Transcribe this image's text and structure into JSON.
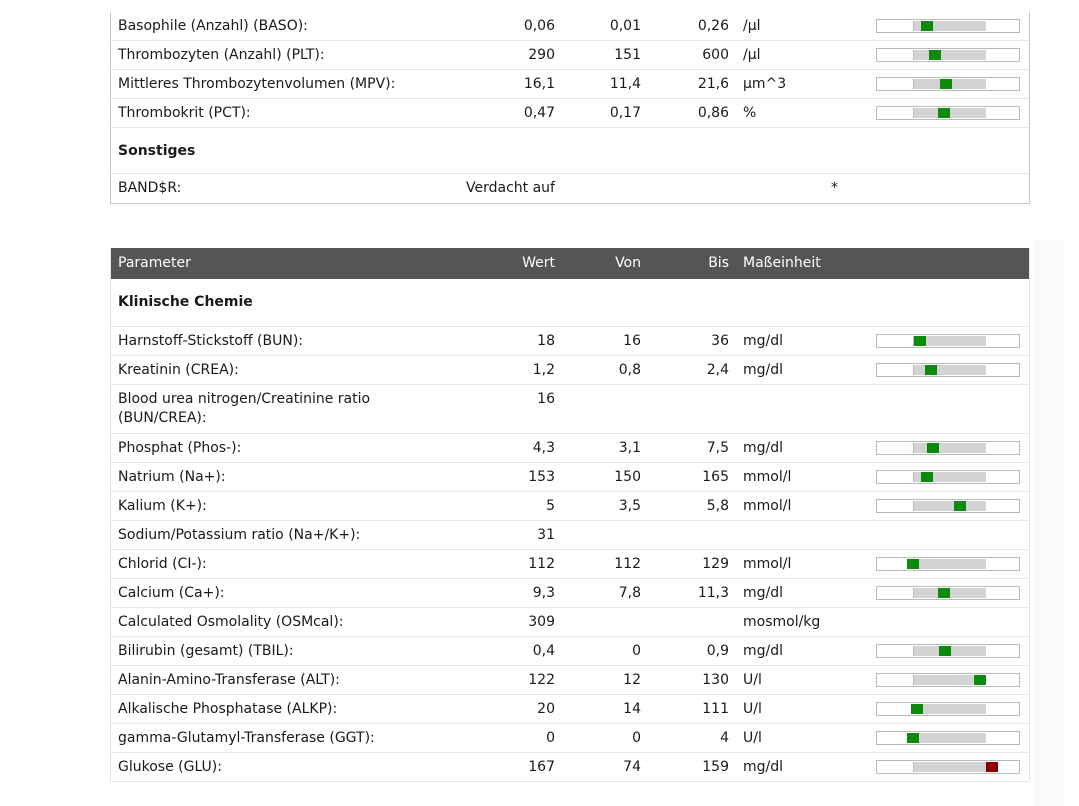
{
  "panel1": {
    "rows": [
      {
        "name": "Basophile (Anzahl) (BASO):",
        "wert": "0,06",
        "von": "0,01",
        "bis": "0,26",
        "unit": "/µl",
        "gauge": {
          "value": 0.06,
          "min": 0.01,
          "max": 0.26
        }
      },
      {
        "name": "Thrombozyten (Anzahl) (PLT):",
        "wert": "290",
        "von": "151",
        "bis": "600",
        "unit": "/µl",
        "gauge": {
          "value": 290,
          "min": 151,
          "max": 600
        }
      },
      {
        "name": "Mittleres Thrombozytenvolumen (MPV):",
        "wert": "16,1",
        "von": "11,4",
        "bis": "21,6",
        "unit": "µm^3",
        "gauge": {
          "value": 16.1,
          "min": 11.4,
          "max": 21.6
        }
      },
      {
        "name": "Thrombokrit (PCT):",
        "wert": "0,47",
        "von": "0,17",
        "bis": "0,86",
        "unit": "%",
        "gauge": {
          "value": 0.47,
          "min": 0.17,
          "max": 0.86
        }
      }
    ],
    "section": "Sonstiges",
    "band": {
      "name": "BAND$R:",
      "wert": "Verdacht auf",
      "flag": "*"
    }
  },
  "panel2": {
    "header": {
      "parameter": "Parameter",
      "wert": "Wert",
      "von": "Von",
      "bis": "Bis",
      "unit": "Maßeinheit"
    },
    "section": "Klinische Chemie",
    "rows": [
      {
        "name": "Harnstoff-Stickstoff (BUN):",
        "wert": "18",
        "von": "16",
        "bis": "36",
        "unit": "mg/dl",
        "gauge": {
          "value": 18,
          "min": 16,
          "max": 36
        }
      },
      {
        "name": "Kreatinin (CREA):",
        "wert": "1,2",
        "von": "0,8",
        "bis": "2,4",
        "unit": "mg/dl",
        "gauge": {
          "value": 1.2,
          "min": 0.8,
          "max": 2.4
        }
      },
      {
        "name": "Blood urea nitrogen/Creatinine ratio (BUN/CREA):",
        "wert": "16",
        "multi": true
      },
      {
        "name": "Phosphat (Phos-):",
        "wert": "4,3",
        "von": "3,1",
        "bis": "7,5",
        "unit": "mg/dl",
        "gauge": {
          "value": 4.3,
          "min": 3.1,
          "max": 7.5
        }
      },
      {
        "name": "Natrium (Na+):",
        "wert": "153",
        "von": "150",
        "bis": "165",
        "unit": "mmol/l",
        "gauge": {
          "value": 153,
          "min": 150,
          "max": 165
        }
      },
      {
        "name": "Kalium (K+):",
        "wert": "5",
        "von": "3,5",
        "bis": "5,8",
        "unit": "mmol/l",
        "gauge": {
          "value": 5,
          "min": 3.5,
          "max": 5.8
        }
      },
      {
        "name": "Sodium/Potassium ratio (Na+/K+):",
        "wert": "31"
      },
      {
        "name": "Chlorid (CI-):",
        "wert": "112",
        "von": "112",
        "bis": "129",
        "unit": "mmol/l",
        "gauge": {
          "value": 112,
          "min": 112,
          "max": 129
        }
      },
      {
        "name": "Calcium (Ca+):",
        "wert": "9,3",
        "von": "7,8",
        "bis": "11,3",
        "unit": "mg/dl",
        "gauge": {
          "value": 9.3,
          "min": 7.8,
          "max": 11.3
        }
      },
      {
        "name": "Calculated Osmolality (OSMcal):",
        "wert": "309",
        "unit": "mosmol/kg"
      },
      {
        "name": "Bilirubin (gesamt) (TBIL):",
        "wert": "0,4",
        "von": "0",
        "bis": "0,9",
        "unit": "mg/dl",
        "gauge": {
          "value": 0.4,
          "min": 0,
          "max": 0.9
        }
      },
      {
        "name": "Alanin-Amino-Transferase (ALT):",
        "wert": "122",
        "von": "12",
        "bis": "130",
        "unit": "U/l",
        "gauge": {
          "value": 122,
          "min": 12,
          "max": 130
        }
      },
      {
        "name": "Alkalische Phosphatase (ALKP):",
        "wert": "20",
        "von": "14",
        "bis": "111",
        "unit": "U/l",
        "gauge": {
          "value": 20,
          "min": 14,
          "max": 111
        }
      },
      {
        "name": "gamma-Glutamyl-Transferase (GGT):",
        "wert": "0",
        "von": "0",
        "bis": "4",
        "unit": "U/l",
        "gauge": {
          "value": 0,
          "min": 0,
          "max": 4
        }
      },
      {
        "name": "Glukose (GLU):",
        "wert": "167",
        "von": "74",
        "bis": "159",
        "unit": "mg/dl",
        "gauge": {
          "value": 167,
          "min": 74,
          "max": 159,
          "status": "high"
        }
      }
    ]
  },
  "colors": {
    "normal": "#0b8a0b",
    "high": "#8b0000",
    "header": "#555555",
    "band": "#d3d3d3"
  }
}
